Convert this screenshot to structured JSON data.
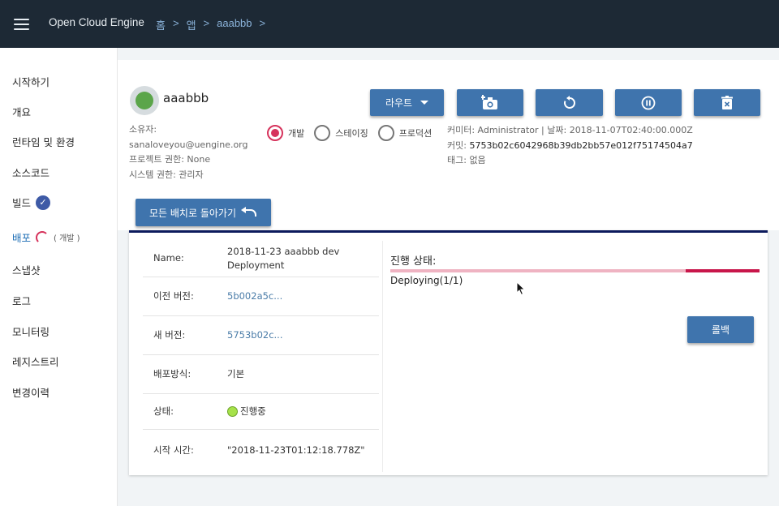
{
  "app": {
    "brand": "Open Cloud Engine",
    "breadcrumb": [
      "홈",
      "앱",
      "aaabbb"
    ],
    "breadcrumb_sep": ">"
  },
  "sidebar": {
    "items": [
      {
        "label": "시작하기"
      },
      {
        "label": "개요"
      },
      {
        "label": "런타임 및 환경"
      },
      {
        "label": "소스코드"
      },
      {
        "label": "빌드",
        "badge": "check-icon"
      },
      {
        "label": "배포",
        "badge": "spinner-icon",
        "sub": "( 개발 )"
      },
      {
        "label": "스냅샷"
      },
      {
        "label": "로그"
      },
      {
        "label": "모니터링"
      },
      {
        "label": "레지스트리"
      },
      {
        "label": "변경이력"
      }
    ]
  },
  "header": {
    "app_name": "aaabbb",
    "owner_label": "소유자:",
    "owner_email": "sanaloveyou@uengine.org",
    "project_permission": "프로젝트 권한: None",
    "system_permission": "시스템 권한: 관리자",
    "environments": [
      {
        "label": "개발",
        "selected": true
      },
      {
        "label": "스테이징",
        "selected": false
      },
      {
        "label": "프로덕션",
        "selected": false
      }
    ],
    "committer": "커미터: Administrator | 날짜: 2018-11-07T02:40:00.000Z",
    "commit_label": "커밋:",
    "commit_hash": "5753b02c6042968b39db2bb57e012f75174504a7",
    "tag": "태그: 없음",
    "toolbar": {
      "route_label": "라우트",
      "route_icon": "caret-down-icon",
      "snapshot_icon": "camera-add-icon",
      "restart_icon": "restart-icon",
      "pause_icon": "pause-icon",
      "delete_icon": "delete-icon"
    }
  },
  "back_button": {
    "label": "모든 배치로 돌아가기"
  },
  "deployment": {
    "rows": [
      {
        "key": "Name:",
        "value": "2018-11-23 aaabbb dev Deployment"
      },
      {
        "key": "이전 버전:",
        "value": "5b002a5c..."
      },
      {
        "key": "새 버전:",
        "value": "5753b02c..."
      },
      {
        "key": "배포방식:",
        "value": "기본"
      },
      {
        "key": "상태:",
        "value": "진행중"
      },
      {
        "key": "시작 시간:",
        "value": "\"2018-11-23T01:12:18.778Z\""
      }
    ],
    "progress_title": "진행 상태:",
    "progress_status": "Deploying(1/1)",
    "progress_fraction": 0.2,
    "rollback_label": "롤백"
  },
  "colors": {
    "topbar": "#1d2935",
    "accent_button": "#3f74ad",
    "progress": "#c8164a",
    "status_ok": "#a6e24a"
  }
}
